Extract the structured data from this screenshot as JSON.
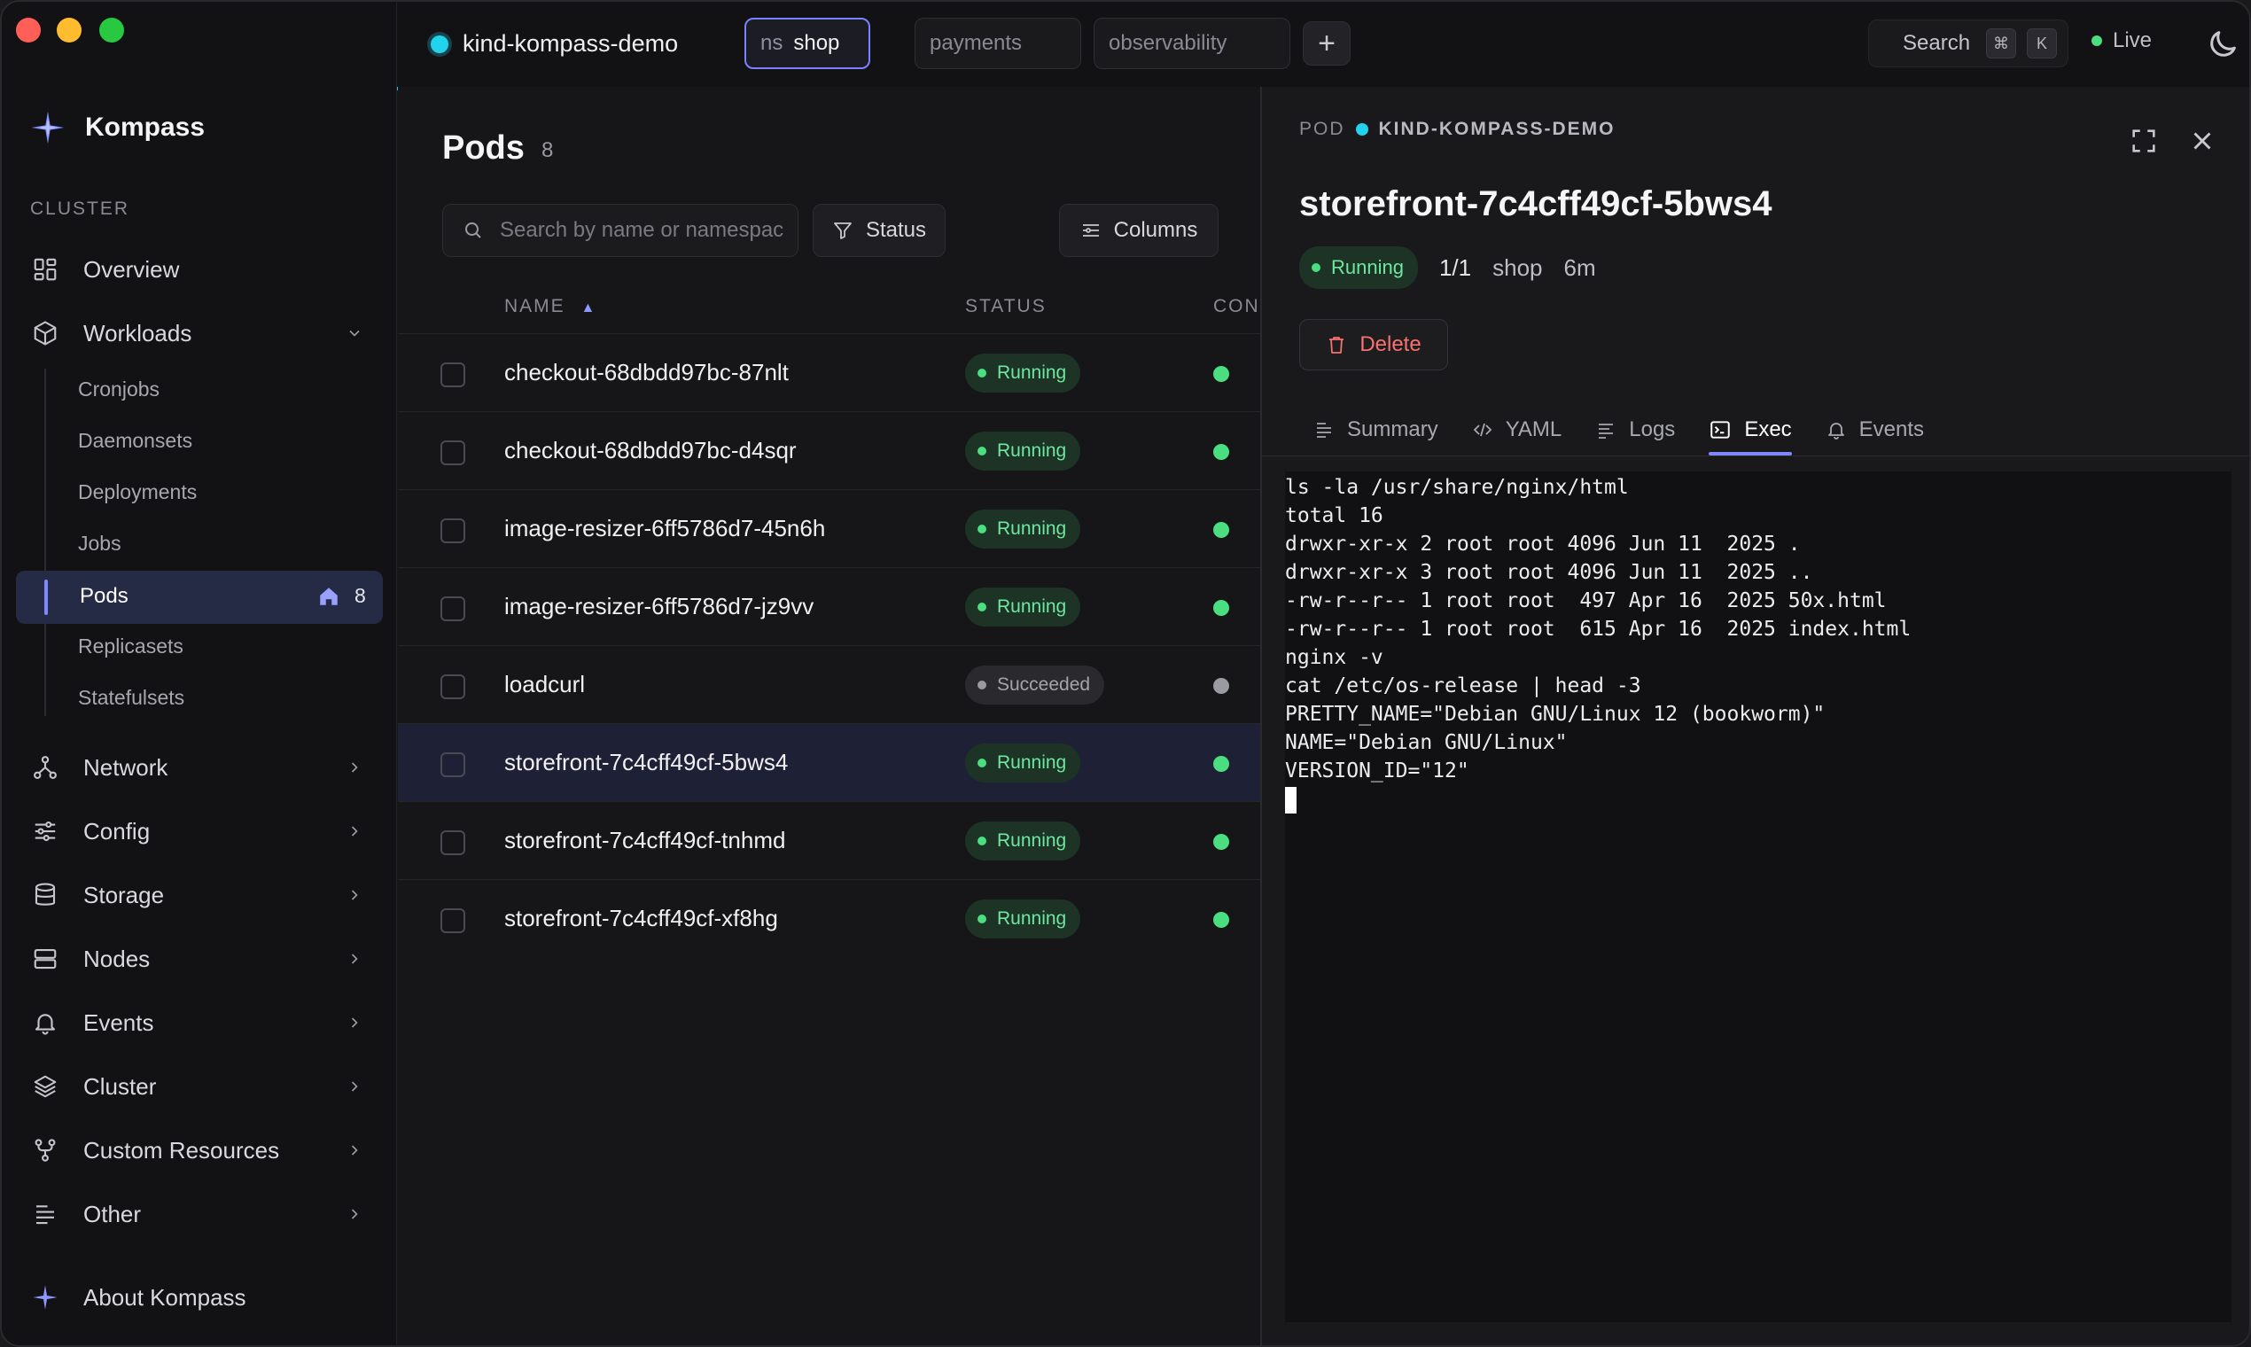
{
  "titlebar": {
    "context": "kind-kompass-demo",
    "tabs": [
      {
        "prefix": "ns",
        "label": "shop",
        "active": true
      },
      {
        "label": "payments"
      },
      {
        "label": "observability"
      }
    ],
    "add_tab": "+",
    "search_label": "Search",
    "shortcut_keys": [
      "⌘",
      "K"
    ],
    "live_label": "Live"
  },
  "sidebar": {
    "brand": "Kompass",
    "section": "CLUSTER",
    "overview": "Overview",
    "workloads": "Workloads",
    "workload_items": [
      "Cronjobs",
      "Daemonsets",
      "Deployments",
      "Jobs",
      "Pods",
      "Replicasets",
      "Statefulsets"
    ],
    "pods_label": "Pods",
    "pods_count": "8",
    "groups": [
      "Network",
      "Config",
      "Storage",
      "Nodes",
      "Events",
      "Cluster",
      "Custom Resources",
      "Other"
    ],
    "about": "About Kompass"
  },
  "main": {
    "title": "Pods",
    "count": "8",
    "search_placeholder": "Search by name or namespace",
    "status_filter": "Status",
    "columns_button": "Columns",
    "headers": {
      "name": "NAME",
      "status": "STATUS",
      "containers": "CON"
    },
    "sort_indicator": "▲",
    "rows": [
      {
        "name": "checkout-68dbdd97bc-87nlt",
        "status": "Running"
      },
      {
        "name": "checkout-68dbdd97bc-d4sqr",
        "status": "Running"
      },
      {
        "name": "image-resizer-6ff5786d7-45n6h",
        "status": "Running"
      },
      {
        "name": "image-resizer-6ff5786d7-jz9vv",
        "status": "Running"
      },
      {
        "name": "loadcurl",
        "status": "Succeeded"
      },
      {
        "name": "storefront-7c4cff49cf-5bws4",
        "status": "Running",
        "selected": true
      },
      {
        "name": "storefront-7c4cff49cf-tnhmd",
        "status": "Running"
      },
      {
        "name": "storefront-7c4cff49cf-xf8hg",
        "status": "Running"
      }
    ]
  },
  "detail": {
    "kind": "POD",
    "cluster": "KIND-KOMPASS-DEMO",
    "name": "storefront-7c4cff49cf-5bws4",
    "status": "Running",
    "ready": "1/1",
    "namespace": "shop",
    "age": "6m",
    "delete_label": "Delete",
    "tabs": [
      "Summary",
      "YAML",
      "Logs",
      "Exec",
      "Events"
    ],
    "active_tab": "Exec",
    "terminal_lines": [
      "ls -la /usr/share/nginx/html",
      "total 16",
      "drwxr-xr-x 2 root root 4096 Jun 11  2025 .",
      "drwxr-xr-x 3 root root 4096 Jun 11  2025 ..",
      "-rw-r--r-- 1 root root  497 Apr 16  2025 50x.html",
      "-rw-r--r-- 1 root root  615 Apr 16  2025 index.html",
      "nginx -v",
      "cat /etc/os-release | head -3",
      "PRETTY_NAME=\"Debian GNU/Linux 12 (bookworm)\"",
      "NAME=\"Debian GNU/Linux\"",
      "VERSION_ID=\"12\""
    ]
  },
  "colors": {
    "accent": "#8088ff",
    "cyan": "#22d3ee",
    "running": "#4ade80",
    "danger": "#f87171"
  }
}
